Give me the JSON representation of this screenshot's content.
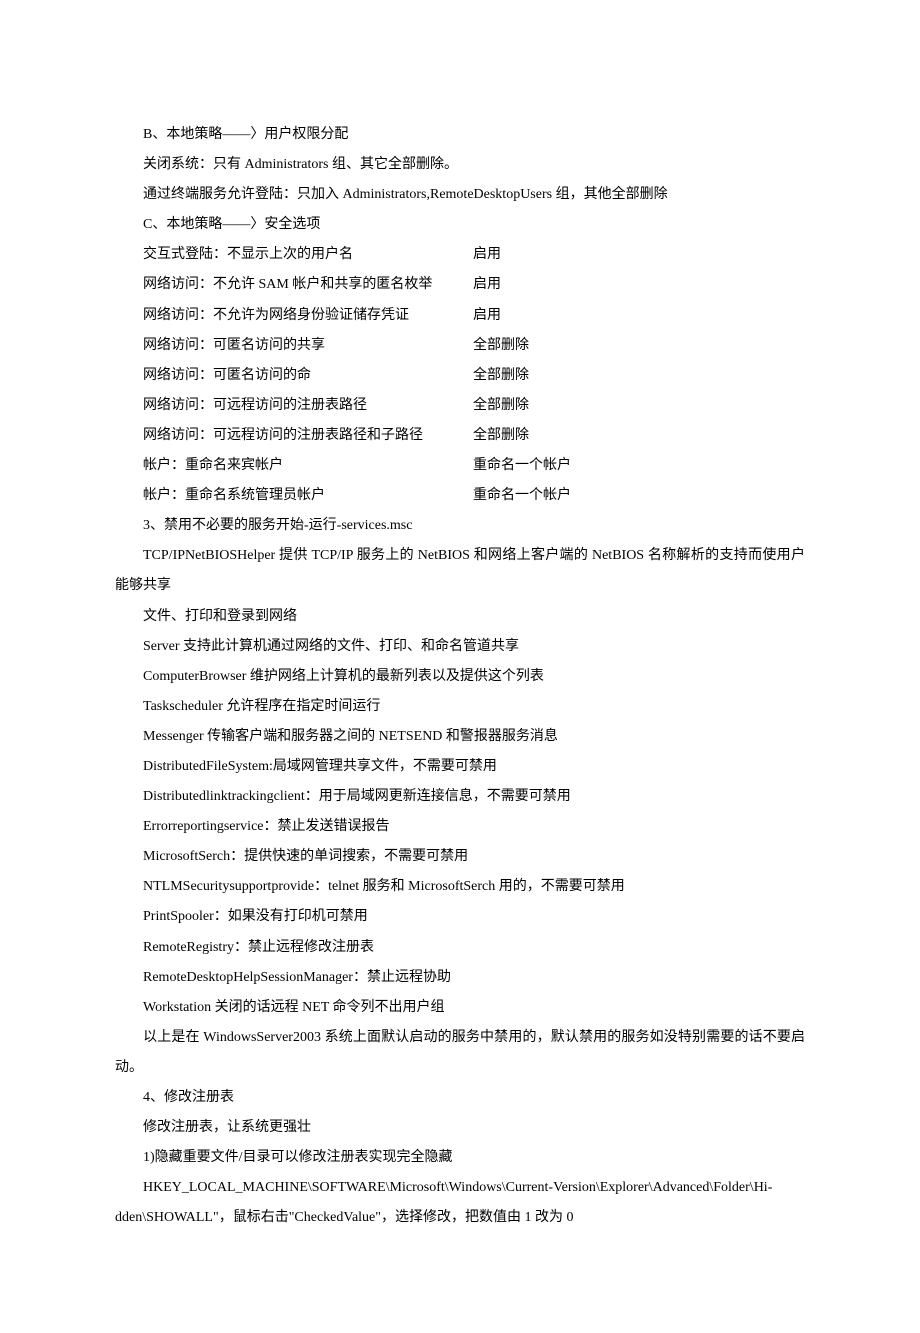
{
  "lines": {
    "l1": "B、本地策略——〉用户权限分配",
    "l2": "关闭系统：只有 Administrators 组、其它全部删除。",
    "l3": "通过终端服务允许登陆：只加入 Administrators,RemoteDesktopUsers 组，其他全部删除",
    "l4": "C、本地策略——〉安全选项"
  },
  "settings": [
    {
      "label": "交互式登陆：不显示上次的用户名",
      "value": "启用"
    },
    {
      "label": "网络访问：不允许 SAM 帐户和共享的匿名枚举",
      "value": "启用"
    },
    {
      "label": "网络访问：不允许为网络身份验证储存凭证",
      "value": "启用"
    },
    {
      "label": "网络访问：可匿名访问的共享",
      "value": "全部删除"
    },
    {
      "label": "网络访问：可匿名访问的命",
      "value": "全部删除"
    },
    {
      "label": "网络访问：可远程访问的注册表路径",
      "value": "全部删除"
    },
    {
      "label": "网络访问：可远程访问的注册表路径和子路径",
      "value": "全部删除"
    },
    {
      "label": "帐户：重命名来宾帐户",
      "value": "重命名一个帐户"
    },
    {
      "label": "帐户：重命名系统管理员帐户",
      "value": "重命名一个帐户"
    }
  ],
  "lines2": {
    "l5": "3、禁用不必要的服务开始-运行-services.msc",
    "l6": "TCP/IPNetBIOSHelper 提供 TCP/IP 服务上的 NetBIOS 和网络上客户端的 NetBIOS 名称解析的支持而使用户能够共享",
    "l7": "文件、打印和登录到网络",
    "l8": "Server 支持此计算机通过网络的文件、打印、和命名管道共享",
    "l9": "ComputerBrowser 维护网络上计算机的最新列表以及提供这个列表",
    "l10": "Taskscheduler 允许程序在指定时间运行",
    "l11": "Messenger 传输客户端和服务器之间的 NETSEND 和警报器服务消息",
    "l12": "DistributedFileSystem:局域网管理共享文件，不需要可禁用",
    "l13": "Distributedlinktrackingclient：用于局域网更新连接信息，不需要可禁用",
    "l14": "Errorreportingservice：禁止发送错误报告",
    "l15": "MicrosoftSerch：提供快速的单词搜索，不需要可禁用",
    "l16": "NTLMSecuritysupportprovide：telnet 服务和 MicrosoftSerch 用的，不需要可禁用",
    "l17": "PrintSpooler：如果没有打印机可禁用",
    "l18": "RemoteRegistry：禁止远程修改注册表",
    "l19": "RemoteDesktopHelpSessionManager：禁止远程协助",
    "l20": "Workstation 关闭的话远程 NET 命令列不出用户组",
    "l21": "以上是在 WindowsServer2003 系统上面默认启动的服务中禁用的，默认禁用的服务如没特别需要的话不要启动。",
    "l22": "4、修改注册表",
    "l23": "修改注册表，让系统更强壮",
    "l24": "1)隐藏重要文件/目录可以修改注册表实现完全隐藏",
    "l25": "HKEY_LOCAL_MACHINE\\SOFTWARE\\Microsoft\\Windows\\Current-Version\\Explorer\\Advanced\\Folder\\Hi-dden\\SHOWALL\"，鼠标右击\"CheckedValue\"，选择修改，把数值由 1 改为 0"
  }
}
